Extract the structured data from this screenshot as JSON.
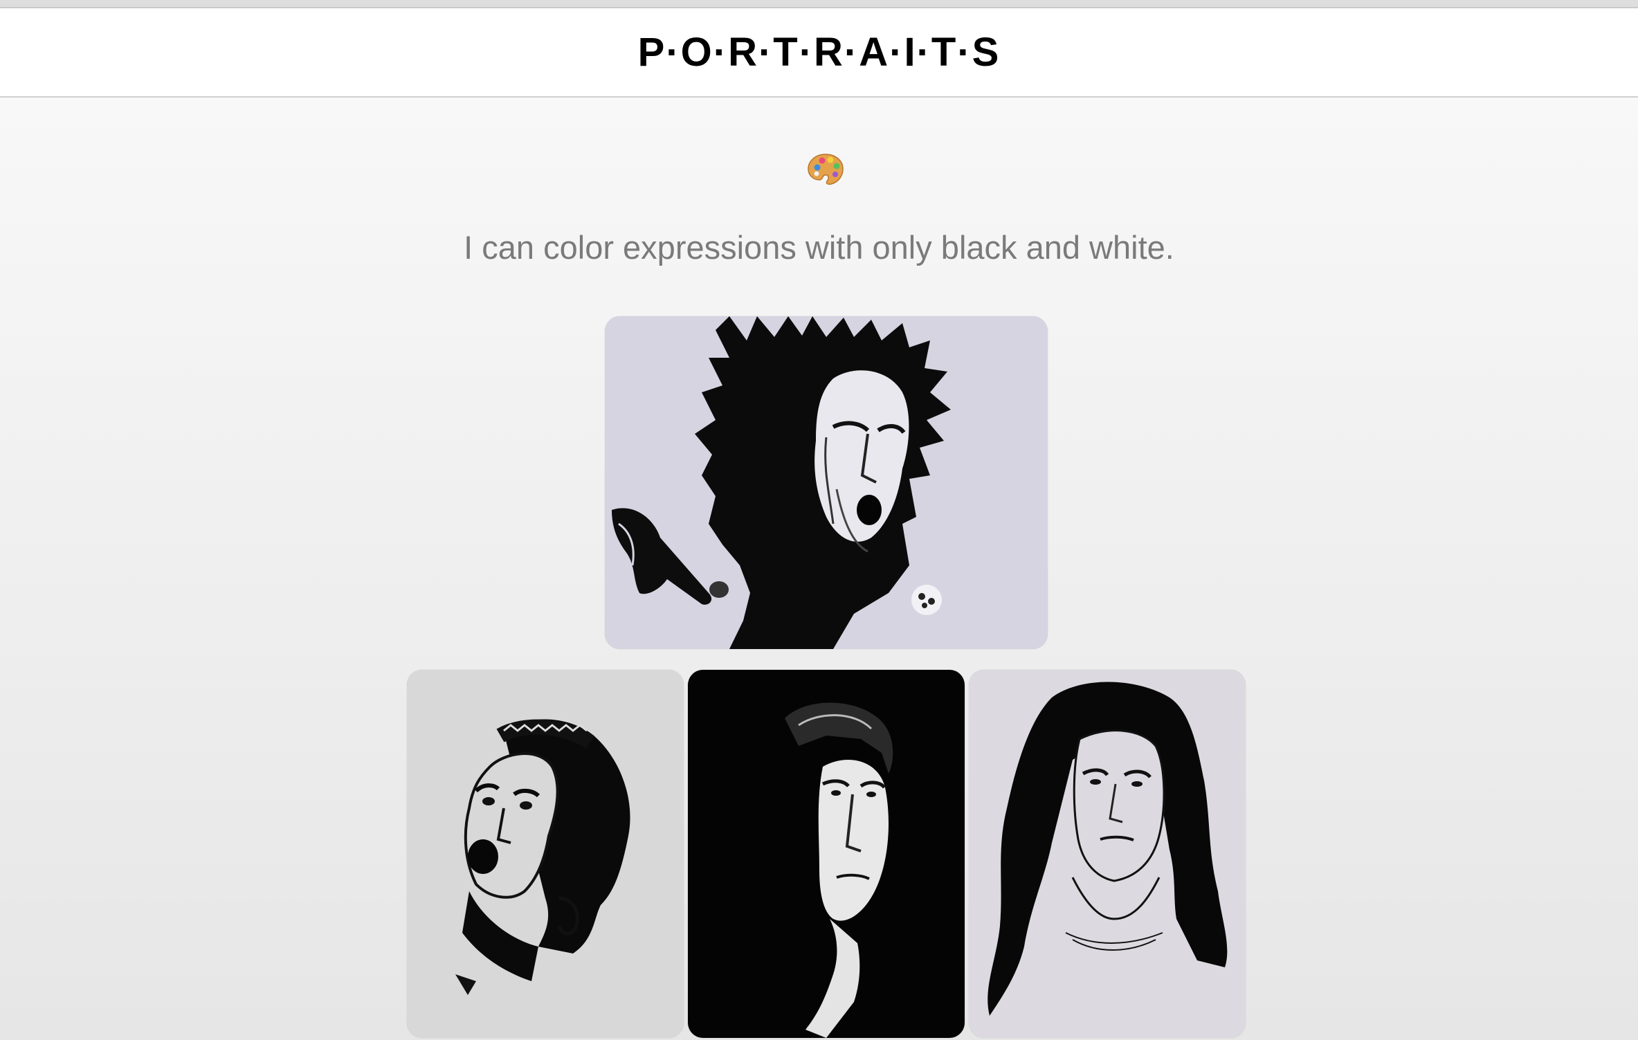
{
  "header": {
    "title": "P·O·R·T·R·A·I·T·S"
  },
  "intro": {
    "icon": "artist-palette-icon",
    "tagline": "I can color expressions with only black and white."
  },
  "gallery": {
    "portraits": [
      {
        "name": "portrait-spiky-hair-smoking"
      },
      {
        "name": "portrait-woman-braided-headband"
      },
      {
        "name": "portrait-man-half-lit"
      },
      {
        "name": "portrait-woman-long-hair"
      }
    ]
  },
  "colors": {
    "text": "#000000",
    "tagline": "#7a7a7a",
    "header_bg": "#ffffff"
  }
}
